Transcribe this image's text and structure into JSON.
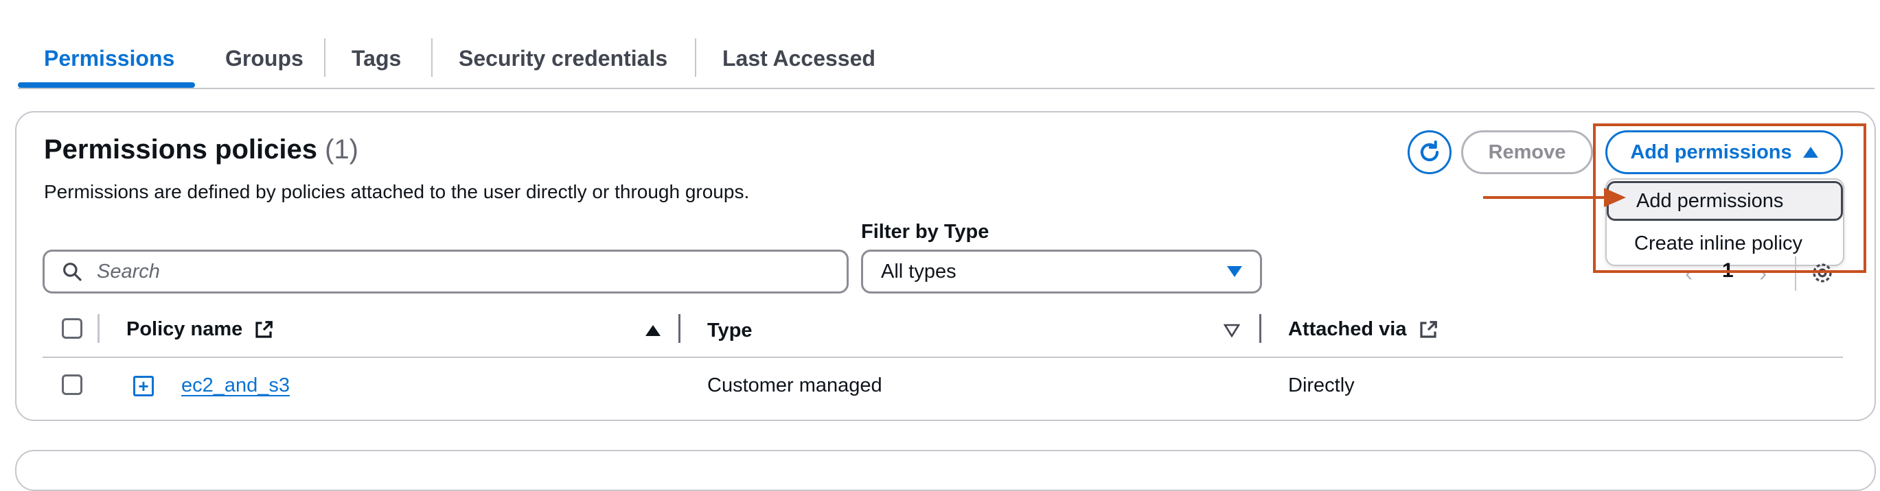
{
  "tabs": [
    {
      "label": "Permissions",
      "active": true
    },
    {
      "label": "Groups",
      "active": false
    },
    {
      "label": "Tags",
      "active": false
    },
    {
      "label": "Security credentials",
      "active": false
    },
    {
      "label": "Last Accessed",
      "active": false
    }
  ],
  "panel": {
    "title": "Permissions policies",
    "count": "(1)",
    "description": "Permissions are defined by policies attached to the user directly or through groups."
  },
  "actions": {
    "refresh_icon": "refresh-icon",
    "remove_label": "Remove",
    "add_permissions_label": "Add permissions"
  },
  "menu": {
    "items": [
      {
        "label": "Add permissions",
        "hovered": true
      },
      {
        "label": "Create inline policy",
        "hovered": false
      }
    ]
  },
  "filter": {
    "label": "Filter by Type",
    "search_placeholder": "Search",
    "type_value": "All types"
  },
  "pagination": {
    "page": "1"
  },
  "table": {
    "headers": [
      "Policy name",
      "Type",
      "Attached via"
    ],
    "rows": [
      {
        "policy_name": "ec2_and_s3",
        "type": "Customer managed",
        "attached_via": "Directly"
      }
    ]
  },
  "colors": {
    "accent": "#0972d3",
    "highlight": "#c8511f",
    "border": "#c6c6cd"
  }
}
